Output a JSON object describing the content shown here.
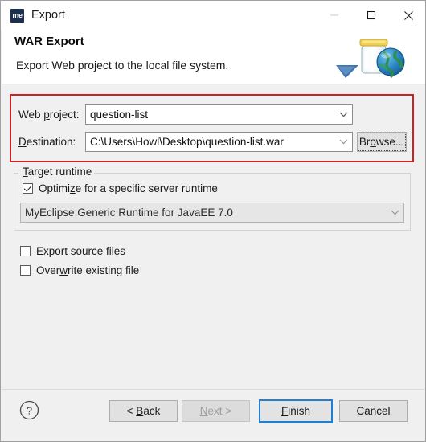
{
  "window": {
    "title": "Export",
    "app_icon_text": "me",
    "controls": [
      {
        "name": "minimize",
        "glyph": "minimize-icon",
        "disabled": true
      },
      {
        "name": "maximize",
        "glyph": "maximize-icon",
        "disabled": false
      },
      {
        "name": "close",
        "glyph": "close-icon",
        "disabled": false
      }
    ]
  },
  "header": {
    "title": "WAR Export",
    "description": "Export Web project to the local file system.",
    "art_icon": "war-jar-globe-icon"
  },
  "highlight": {
    "color": "#cc2222",
    "label": "red-highlight-rect"
  },
  "form": {
    "web_project": {
      "label_pre": "Web ",
      "label_mnemonic": "p",
      "label_post": "roject:",
      "value": "question-list"
    },
    "destination": {
      "label_mnemonic": "D",
      "label_post": "estination:",
      "value": "C:\\Users\\Howl\\Desktop\\question-list.war"
    },
    "browse_button": {
      "label_pre": "Br",
      "label_mnemonic": "o",
      "label_post": "wse..."
    }
  },
  "target_runtime": {
    "group_mnemonic": "T",
    "group_post": "arget runtime",
    "optimize_checkbox": {
      "checked": true,
      "label_pre": "Optimi",
      "label_mnemonic": "z",
      "label_post": "e for a specific server runtime"
    },
    "runtime_combo": {
      "value": "MyEclipse Generic Runtime for JavaEE 7.0",
      "disabled": true
    }
  },
  "options": [
    {
      "name": "export-source-files",
      "checked": false,
      "label_pre": "Export ",
      "label_mnemonic": "s",
      "label_post": "ource files"
    },
    {
      "name": "overwrite-existing-file",
      "checked": false,
      "label_pre": "Over",
      "label_mnemonic": "w",
      "label_post": "rite existing file"
    }
  ],
  "footer": {
    "help_icon": "help-question-icon",
    "buttons": {
      "back": {
        "pre": "< ",
        "mnemonic": "B",
        "post": "ack",
        "disabled": false,
        "default": false
      },
      "next": {
        "pre": "",
        "mnemonic": "N",
        "post": "ext >",
        "disabled": true,
        "default": false
      },
      "finish": {
        "pre": "",
        "mnemonic": "F",
        "post": "inish",
        "disabled": false,
        "default": true
      },
      "cancel": {
        "pre": "",
        "mnemonic": "",
        "post": "Cancel",
        "disabled": false,
        "default": false
      }
    },
    "accent_color": "#1e7fd4"
  }
}
